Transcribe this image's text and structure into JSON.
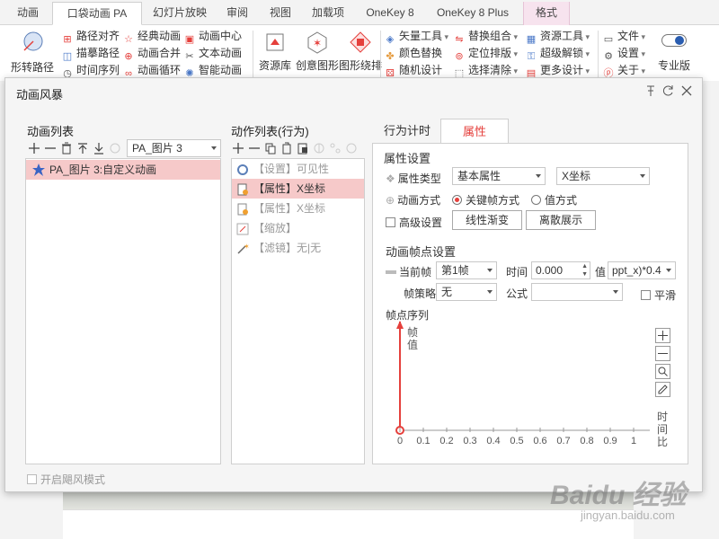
{
  "ribbon": {
    "tabs": [
      "动画",
      "口袋动画 PA",
      "幻灯片放映",
      "审阅",
      "视图",
      "加载项",
      "OneKey 8",
      "OneKey 8 Plus",
      "格式"
    ],
    "col1": [
      "路径对齐",
      "描摹路径",
      "时间序列"
    ],
    "col2": [
      "经典动画",
      "动画合并",
      "动画循环"
    ],
    "col3": [
      "动画中心",
      "文本动画",
      "智能动画"
    ],
    "big": [
      "资源库",
      "创意图形",
      "图形绕排"
    ],
    "col4": [
      "矢量工具",
      "颜色替换",
      "随机设计"
    ],
    "col5": [
      "替换组合",
      "定位排版",
      "选择清除"
    ],
    "col6": [
      "资源工具",
      "超级解锁",
      "更多设计"
    ],
    "col7": [
      "文件",
      "设置",
      "关于"
    ],
    "left_big": "形转路径",
    "pro": "专业版"
  },
  "dialog": {
    "title": "动画风暴",
    "anim_list": {
      "label": "动画列表",
      "selector": "PA_图片 3",
      "items": [
        "PA_图片 3:自定义动画"
      ]
    },
    "action_list": {
      "label": "动作列表(行为)",
      "items": [
        {
          "text": "【设置】可见性"
        },
        {
          "text": "【属性】X坐标"
        },
        {
          "text": "【属性】X坐标"
        },
        {
          "text": "【缩放】"
        },
        {
          "text": "【滤镜】无|无"
        }
      ]
    },
    "tabs": {
      "timing": "行为计时",
      "props": "属性"
    },
    "props": {
      "section": "属性设置",
      "type_label": "属性类型",
      "type_value": "基本属性",
      "attr_value": "X坐标",
      "mode_label": "动画方式",
      "mode_keyframe": "关键帧方式",
      "mode_value": "值方式",
      "advanced": "高级设置",
      "linear_btn": "线性渐变",
      "discrete_btn": "离散展示"
    },
    "keyframes": {
      "section": "动画帧点设置",
      "current_label": "当前帧",
      "current_value": "第1帧",
      "time_label": "时间",
      "time_value": "0.000",
      "value_label": "值",
      "value_value": "ppt_x)*0.4",
      "strategy_label": "帧策略",
      "strategy_value": "无",
      "formula_label": "公式",
      "smooth": "平滑"
    },
    "graph": {
      "label": "帧点序列",
      "ylabel": "帧值",
      "xlabel": "时间比",
      "ticks": [
        "0",
        "0.1",
        "0.2",
        "0.3",
        "0.4",
        "0.5",
        "0.6",
        "0.7",
        "0.8",
        "0.9",
        "1"
      ]
    },
    "footer": "开启飓风模式"
  },
  "watermark": {
    "brand": "Baidu 经验",
    "url": "jingyan.baidu.com"
  },
  "colors": {
    "accent": "#e5403c",
    "selection": "#f6c9c9",
    "format_tab": "#f7e3ee"
  }
}
